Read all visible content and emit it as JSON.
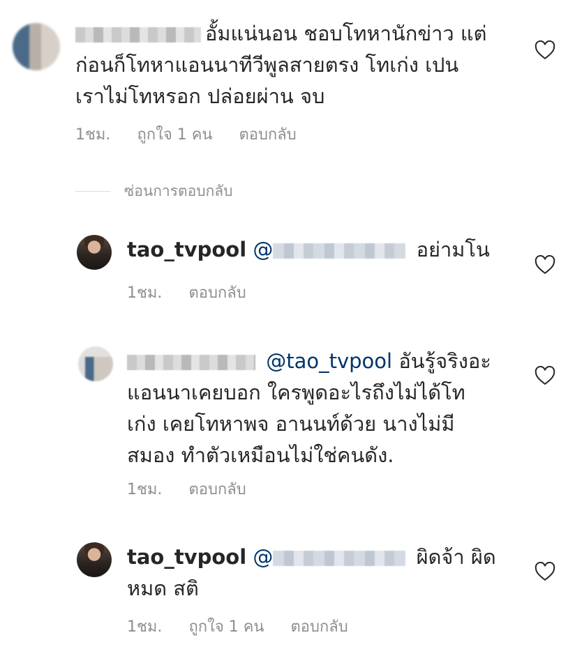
{
  "comments": [
    {
      "username_hidden": true,
      "text": "อั้มแน่นอน ชอบโทหานักข่าว แต่",
      "text_line2": "ก่อนก็โทหาแอนนาทีวีพูลสายตรง โทเก่ง เปน",
      "text_line3": "เราไม่โทหรอก  ปล่อยผ่าน จบ",
      "time": "1ชม.",
      "likes": "ถูกใจ 1 คน",
      "reply": "ตอบกลับ"
    },
    {
      "username": "tao_tvpool",
      "mention_prefix": "@",
      "text": "อย่ามโน",
      "time": "1ชม.",
      "reply": "ตอบกลับ"
    },
    {
      "mention": "@tao_tvpool",
      "text": "อันรู้จริงอะ",
      "text_line2": "แอนนาเคยบอก  ใครพูดอะไรถึงไม่ได้โท",
      "text_line3": "เก่ง เคยโทหาพจ อานนท์ด้วย นางไม่มี",
      "text_line4": "สมอง ทำตัวเหมือนไม่ใช่คนดัง.",
      "time": "1ชม.",
      "reply": "ตอบกลับ"
    },
    {
      "username": "tao_tvpool",
      "mention_prefix": "@",
      "text": "ผิดจ้า ผิด",
      "text_line2": "หมด สติ",
      "time": "1ชม.",
      "likes": "ถูกใจ 1 คน",
      "reply": "ตอบกลับ"
    }
  ],
  "hide_replies": "ซ่อนการตอบกลับ",
  "colors": {
    "text": "#262626",
    "meta": "#8e8e8e",
    "mention": "#003569"
  }
}
